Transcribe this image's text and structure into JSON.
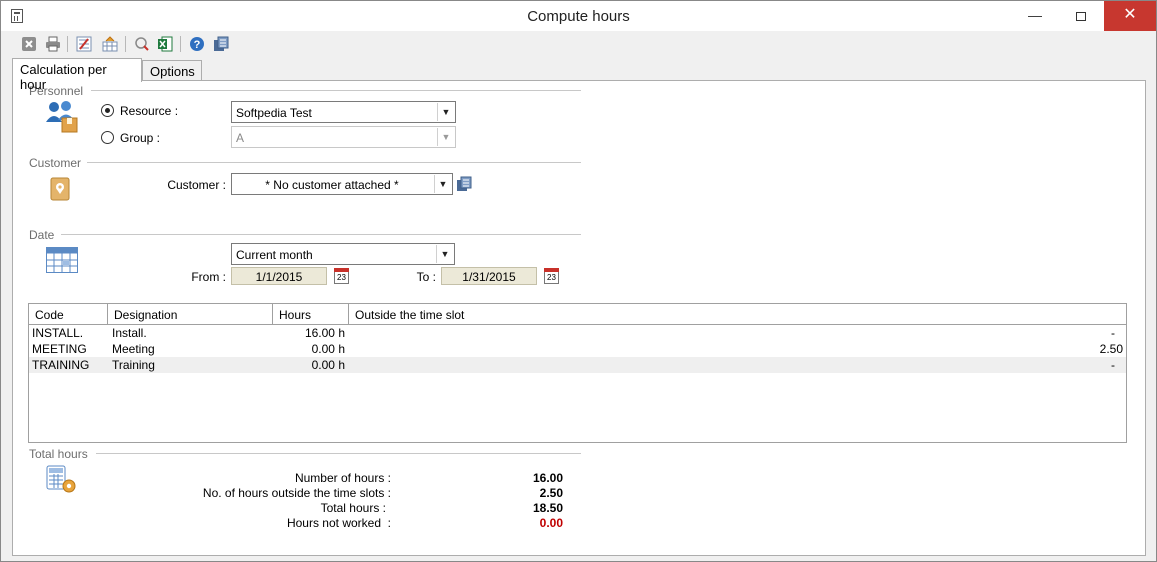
{
  "window": {
    "title": "Compute hours",
    "minimize": "—",
    "close": "✕"
  },
  "tabs": [
    {
      "label": "Calculation per hour"
    },
    {
      "label": "Options"
    }
  ],
  "personnel": {
    "header": "Personnel",
    "resource_label": "Resource :",
    "resource_value": "Softpedia Test",
    "group_label": "Group :",
    "group_value": "A"
  },
  "customer": {
    "header": "Customer",
    "label": "Customer :",
    "value": "* No customer attached *"
  },
  "date": {
    "header": "Date",
    "period": "Current month",
    "from_label": "From :",
    "from_value": "1/1/2015",
    "to_label": "To :",
    "to_value": "1/31/2015",
    "calendar_day": "23"
  },
  "table": {
    "columns": [
      "Code",
      "Designation",
      "Hours",
      "Outside the time slot"
    ],
    "rows": [
      {
        "code": "INSTALL.",
        "designation": "Install.",
        "hours": "16.00 h",
        "outside": "-"
      },
      {
        "code": "MEETING",
        "designation": "Meeting",
        "hours": "0.00 h",
        "outside": "2.50"
      },
      {
        "code": "TRAINING",
        "designation": "Training",
        "hours": "0.00 h",
        "outside": "-"
      }
    ]
  },
  "totals": {
    "header": "Total hours",
    "items": [
      {
        "label": "Number of hours :",
        "value": "16.00"
      },
      {
        "label": "No. of hours outside the time slots :",
        "value": "2.50"
      },
      {
        "label": "Total hours :",
        "value": "18.50"
      },
      {
        "label": "Hours not worked  :",
        "value": "0.00"
      }
    ]
  },
  "colors": {
    "close_button": "#c7372f",
    "hours_not_worked": "#c00000"
  },
  "toolbar_icons": [
    "close-icon",
    "print-icon",
    "filter-icon",
    "chart-icon",
    "clear-icon",
    "excel-icon",
    "help-icon",
    "window-icon"
  ]
}
